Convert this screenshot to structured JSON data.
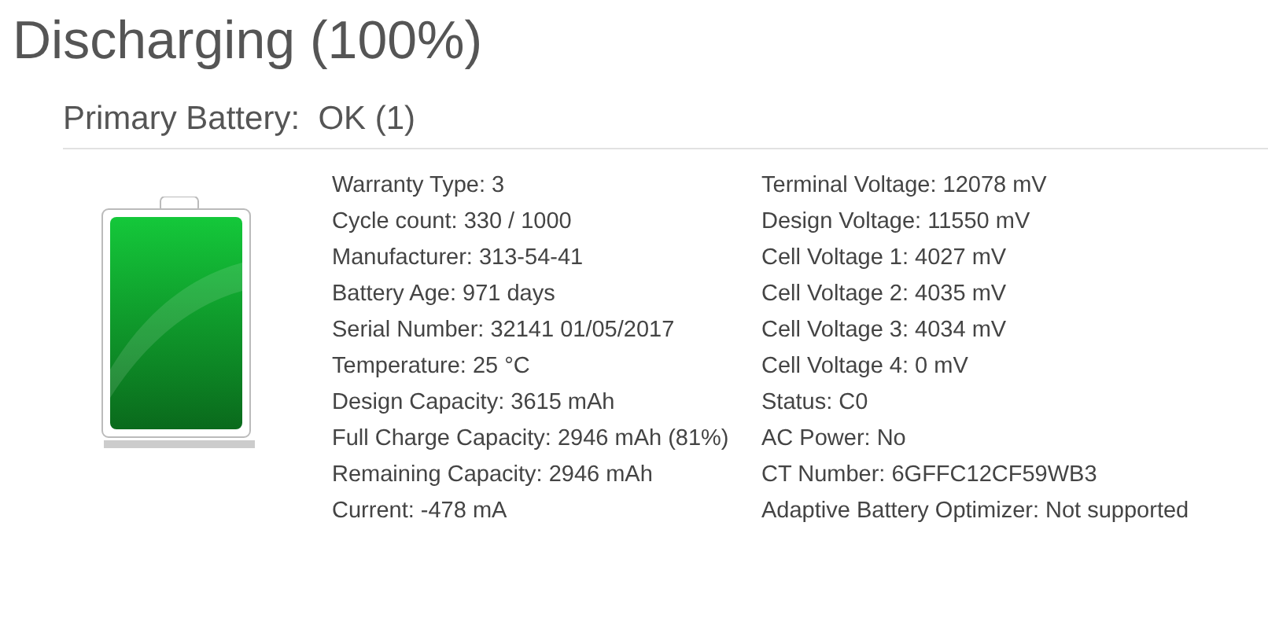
{
  "title": "Discharging (100%)",
  "section": {
    "heading": "Primary Battery:  OK (1)"
  },
  "left_details": [
    "Warranty Type: 3",
    "Cycle count: 330 / 1000",
    "Manufacturer: 313-54-41",
    "Battery Age: 971 days",
    "Serial Number: 32141 01/05/2017",
    "Temperature: 25 °C",
    "Design Capacity: 3615 mAh",
    "Full Charge Capacity: 2946 mAh (81%)",
    "Remaining Capacity: 2946 mAh",
    "Current: -478 mA"
  ],
  "right_details": [
    "Terminal Voltage: 12078 mV",
    "Design Voltage: 11550 mV",
    "Cell Voltage 1: 4027 mV",
    "Cell Voltage 2: 4035 mV",
    "Cell Voltage 3: 4034 mV",
    "Cell Voltage 4: 0 mV",
    "Status: C0",
    "AC Power: No",
    "CT Number: 6GFFC12CF59WB3",
    "Adaptive Battery Optimizer: Not supported"
  ]
}
